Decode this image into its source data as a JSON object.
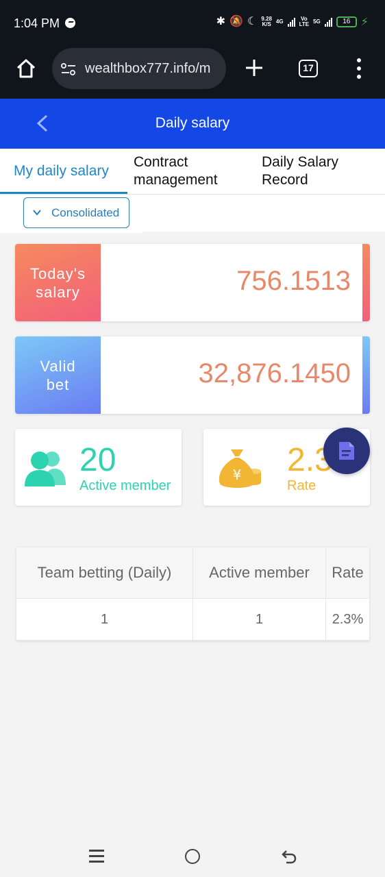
{
  "status_bar": {
    "time": "1:04 PM",
    "speed_value": "9.28",
    "speed_unit": "K/S",
    "net1_label": "4G",
    "volte_top": "Vo",
    "volte_bottom": "LTE",
    "net2_label": "5G",
    "battery": "16"
  },
  "browser": {
    "url": "wealthbox777.info/m",
    "tab_count": "17"
  },
  "header": {
    "title": "Daily salary"
  },
  "tabs": [
    {
      "line1": "My daily salary",
      "line2": ""
    },
    {
      "line1": "Contract",
      "line2": "management"
    },
    {
      "line1": "Daily Salary",
      "line2": "Record"
    }
  ],
  "filter": {
    "selected": "Consolidated"
  },
  "cards": {
    "todays_salary": {
      "label_line1": "Today's",
      "label_line2": "salary",
      "value": "756.1513"
    },
    "valid_bet": {
      "label_line1": "Valid",
      "label_line2": "bet",
      "value": "32,876.1450"
    }
  },
  "mini_cards": {
    "active_member": {
      "value": "20",
      "caption": "Active member"
    },
    "rate": {
      "value": "2.3",
      "caption": "Rate"
    }
  },
  "table": {
    "headers": [
      "Team betting (Daily)",
      "Active member",
      "Rate"
    ],
    "rows": [
      [
        "1",
        "1",
        "2.3%"
      ]
    ]
  },
  "colors": {
    "header_blue": "#1348e7",
    "tab_active": "#1e86c8",
    "salary_value": "#e8886a",
    "teal": "#2dd3b0",
    "gold": "#f2b634"
  }
}
